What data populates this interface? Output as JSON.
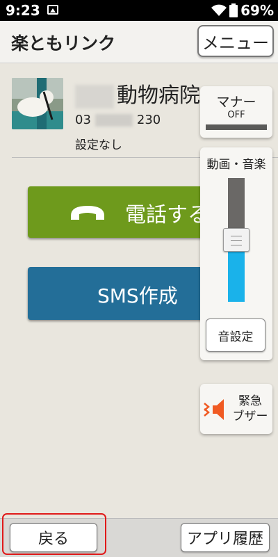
{
  "status_bar": {
    "time": "9:23",
    "battery": "69%",
    "icons": [
      "gallery-icon",
      "wifi-icon",
      "battery-icon"
    ]
  },
  "header": {
    "title": "楽ともリンク",
    "menu_label": "メニュー"
  },
  "contact": {
    "name_visible": "動物病院",
    "phone_prefix": "03",
    "phone_suffix": "230",
    "setting": "設定なし"
  },
  "actions": {
    "call_label": "電話する",
    "sms_label": "SMS作成"
  },
  "side_panel": {
    "manner_label": "マナー",
    "manner_state": "OFF",
    "volume_label": "動画・音楽",
    "volume_level": 0.5,
    "sound_settings_label": "音設定",
    "buzzer_label_line1": "緊急",
    "buzzer_label_line2": "ブザー"
  },
  "bottom_bar": {
    "back_label": "戻る",
    "history_label": "アプリ履歴"
  },
  "colors": {
    "call_button": "#6e9a1c",
    "sms_button": "#236e98",
    "volume_fill": "#1ab2ea",
    "buzzer_icon": "#f05a22",
    "highlight": "#e01919"
  }
}
